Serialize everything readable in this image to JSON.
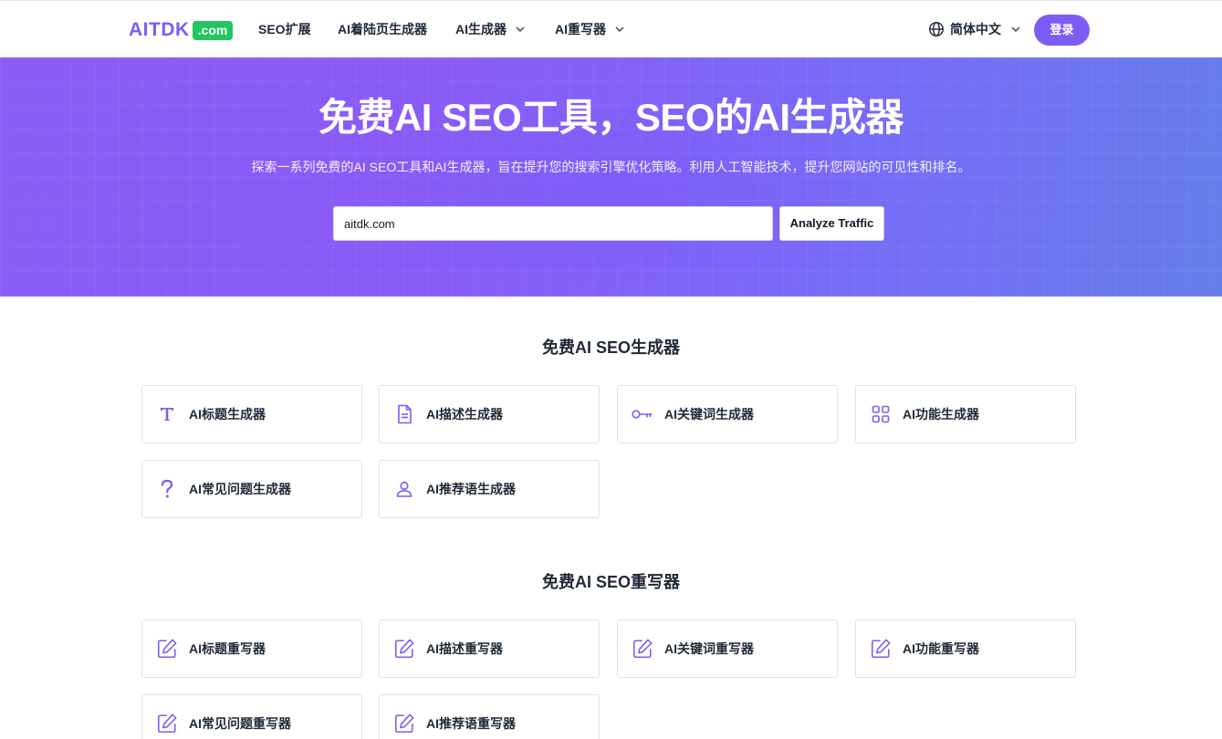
{
  "header": {
    "logo_text": "AITDK",
    "logo_badge": ".com",
    "nav": [
      "SEO扩展",
      "AI着陆页生成器",
      "AI生成器",
      "AI重写器"
    ],
    "language": "简体中文",
    "login": "登录"
  },
  "hero": {
    "title": "免费AI SEO工具，SEO的AI生成器",
    "subtitle": "探索一系列免费的AI SEO工具和AI生成器，旨在提升您的搜索引擎优化策略。利用人工智能技术，提升您网站的可见性和排名。",
    "search_value": "aitdk.com",
    "analyze_button": "Analyze Traffic"
  },
  "generators": {
    "title": "免费AI SEO生成器",
    "items": [
      {
        "label": "AI标题生成器",
        "icon": "text-icon"
      },
      {
        "label": "AI描述生成器",
        "icon": "document-icon"
      },
      {
        "label": "AI关键词生成器",
        "icon": "key-icon"
      },
      {
        "label": "AI功能生成器",
        "icon": "grid-icon"
      },
      {
        "label": "AI常见问题生成器",
        "icon": "question-icon"
      },
      {
        "label": "AI推荐语生成器",
        "icon": "user-icon"
      }
    ]
  },
  "rewriters": {
    "title": "免费AI SEO重写器",
    "items": [
      {
        "label": "AI标题重写器",
        "icon": "edit-icon"
      },
      {
        "label": "AI描述重写器",
        "icon": "edit-icon"
      },
      {
        "label": "AI关键词重写器",
        "icon": "edit-icon"
      },
      {
        "label": "AI功能重写器",
        "icon": "edit-icon"
      },
      {
        "label": "AI常见问题重写器",
        "icon": "edit-icon"
      },
      {
        "label": "AI推荐语重写器",
        "icon": "edit-icon"
      }
    ]
  },
  "colors": {
    "brand": "#7c5cf5",
    "badge": "#22c55e",
    "hero_start": "#8b5cf6",
    "hero_end": "#667eea"
  }
}
